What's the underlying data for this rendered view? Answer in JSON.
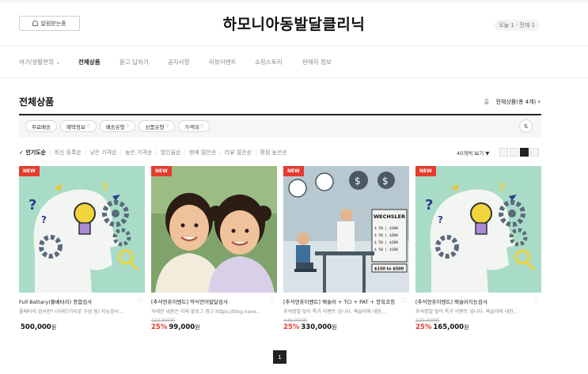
{
  "header": {
    "notify_label": "알림받는중",
    "shop_title": "하모니아동발달클리닉",
    "visitors": "오늘 1 · 전체 1"
  },
  "nav": {
    "items": [
      {
        "label": "여가/생활편의",
        "has_caret": true
      },
      {
        "label": "전체상품"
      },
      {
        "label": "묻고 답하기"
      },
      {
        "label": "공지사항"
      },
      {
        "label": "리뷰이벤트"
      },
      {
        "label": "쇼핑스토리"
      },
      {
        "label": "판매자 정보"
      }
    ]
  },
  "section": {
    "title": "전체상품",
    "breadcrumb_home": "홈",
    "breadcrumb_current": "전체상품(총 4개)"
  },
  "filters": [
    "무료배송",
    "혜택정보",
    "배송유형",
    "상품유형",
    "가격대"
  ],
  "sort": {
    "active": "인기도순",
    "options": [
      "최신 등록순",
      "낮은 가격순",
      "높은 가격순",
      "할인율순",
      "판매 많은순",
      "리뷰 많은순",
      "평점 높은순"
    ]
  },
  "view_count": "40개씩 보기",
  "products": [
    {
      "badge": "NEW",
      "name": "Full Battary(풀베터리) 종합검사",
      "desc": "풀베터리 검사란? (아래7가지로 구성 됨) 지능검사...",
      "original_price": "",
      "discount": "",
      "price": "500,000",
      "currency": "원",
      "image_type": "brain",
      "colors": {
        "bg": "#a9dcc6",
        "head": "#f3f5f2",
        "gear": "#5a6b7b",
        "bulb": "#f2d43b"
      }
    },
    {
      "badge": "NEW",
      "name": "[추석연휴이벤트] 약식언어발달검사",
      "desc": "자세한 내용은 아래 블로그 참고 https://blog.nave...",
      "original_price": "132,000원",
      "discount": "25%",
      "price": "99,000",
      "currency": "원",
      "image_type": "children",
      "colors": {
        "bg": "#7fa36a",
        "skin": "#f0c29c",
        "hair": "#2b1d14",
        "shirt": "#f2ecdc"
      }
    },
    {
      "badge": "NEW",
      "name": "[추석연휴이벤트] 웩슬러 + TCI + PAT + 양육코칭",
      "desc": "추석명절 맞이 특가 이벤트 입니다. 웩슬러에 대한...",
      "original_price": "440,000원",
      "discount": "25%",
      "price": "330,000",
      "currency": "원",
      "image_type": "test",
      "sign_title": "WECHSLER",
      "sign_lines": [
        "$ 50 | $100",
        "$ 50 | $300",
        "$ 50 | $200",
        "$ 50 | $180"
      ],
      "price_range": "$150 to $500",
      "colors": {
        "bg": "#d9e2e6",
        "board": "#9fb3bd",
        "desk": "#4a5963"
      }
    },
    {
      "badge": "NEW",
      "name": "[추석연휴이벤트] 웩슬러지능검사",
      "desc": "추석명절 맞이 특가 이벤트 입니다. 웩슬러에 대한...",
      "original_price": "220,000원",
      "discount": "25%",
      "price": "165,000",
      "currency": "원",
      "image_type": "brain",
      "colors": {
        "bg": "#a9dcc6",
        "head": "#f3f5f2",
        "gear": "#5a6b7b",
        "bulb": "#f2d43b"
      }
    }
  ],
  "pagination": {
    "current": "1"
  }
}
